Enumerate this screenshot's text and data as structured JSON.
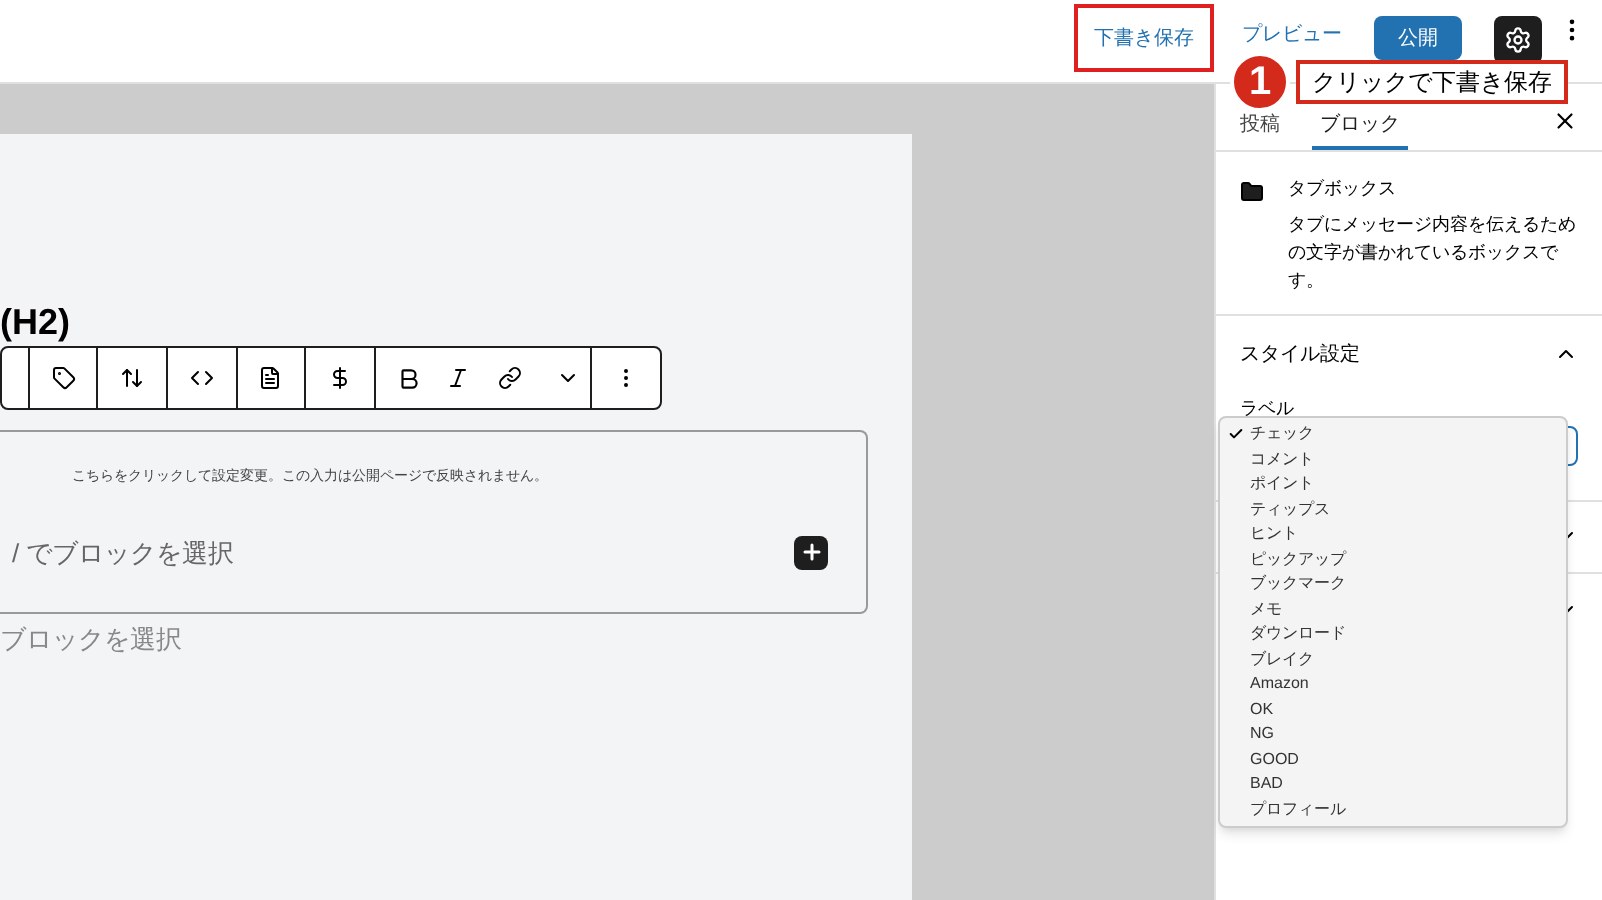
{
  "header": {
    "buttons": [
      {
        "label": "下書き保存",
        "kind": "link",
        "highlighted": true
      },
      {
        "label": "プレビュー",
        "kind": "link",
        "highlighted": false
      },
      {
        "label": "公開",
        "kind": "primary",
        "highlighted": false
      }
    ]
  },
  "annotation": {
    "number": "1",
    "text": "クリックで下書き保存"
  },
  "editor": {
    "heading": "(H2)",
    "block": {
      "note": "こちらをクリックして設定変更。この入力は公開ページで反映されません。",
      "placeholder": "/ でブロックを選択"
    },
    "next_placeholder": "ブロックを選択"
  },
  "sidebar": {
    "tabs": [
      {
        "label": "投稿",
        "selected": false
      },
      {
        "label": "ブロック",
        "selected": true
      }
    ],
    "block": {
      "name": "タブボックス",
      "description": "タブにメッセージ内容を伝えるための文字が書かれているボックスです。"
    },
    "panel": {
      "title": "スタイル設定",
      "expanded": true,
      "field_label": "ラベル"
    },
    "dropdown": {
      "options": [
        {
          "label": "チェック",
          "selected": true
        },
        {
          "label": "コメント",
          "selected": false
        },
        {
          "label": "ポイント",
          "selected": false
        },
        {
          "label": "ティップス",
          "selected": false
        },
        {
          "label": "ヒント",
          "selected": false
        },
        {
          "label": "ピックアップ",
          "selected": false
        },
        {
          "label": "ブックマーク",
          "selected": false
        },
        {
          "label": "メモ",
          "selected": false
        },
        {
          "label": "ダウンロード",
          "selected": false
        },
        {
          "label": "ブレイク",
          "selected": false
        },
        {
          "label": "Amazon",
          "selected": false
        },
        {
          "label": "OK",
          "selected": false
        },
        {
          "label": "NG",
          "selected": false
        },
        {
          "label": "GOOD",
          "selected": false
        },
        {
          "label": "BAD",
          "selected": false
        },
        {
          "label": "プロフィール",
          "selected": false
        }
      ]
    }
  }
}
